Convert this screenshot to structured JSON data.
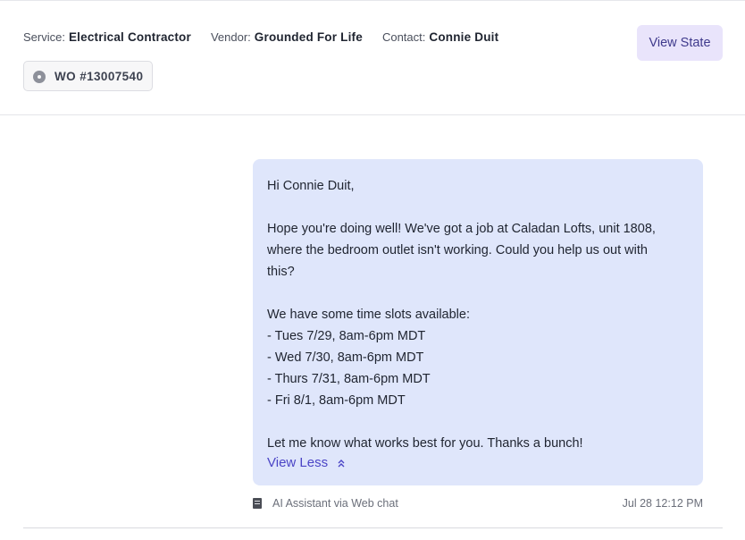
{
  "header": {
    "service_label": "Service:",
    "service_value": "Electrical Contractor",
    "vendor_label": "Vendor:",
    "vendor_value": "Grounded For Life",
    "contact_label": "Contact:",
    "contact_value": "Connie Duit",
    "view_state_label": "View State",
    "work_order": "WO #13007540"
  },
  "message": {
    "greeting": "Hi Connie Duit,",
    "body_line1": "Hope you're doing well! We've got a job at Caladan Lofts, unit 1808,",
    "body_line2": "where the bedroom outlet isn't working. Could you help us out with",
    "body_line3": "this?",
    "slots_intro": "We have some time slots available:",
    "slots": [
      "- Tues 7/29, 8am-6pm MDT",
      "- Wed 7/30, 8am-6pm MDT",
      "- Thurs 7/31, 8am-6pm MDT",
      "- Fri 8/1, 8am-6pm MDT"
    ],
    "closing": "Let me know what works best for you. Thanks a bunch!",
    "view_less_label": "View Less",
    "source": "AI Assistant via Web chat",
    "timestamp": "Jul 28 12:12 PM"
  },
  "icons": {
    "work_order_status": "circle-dot-icon",
    "view_less": "double-chevron-up-icon",
    "source": "document-icon"
  },
  "colors": {
    "bubble_bg": "#dfe6fb",
    "accent": "#4b45c6",
    "view_state_bg": "#e9e4fb"
  }
}
